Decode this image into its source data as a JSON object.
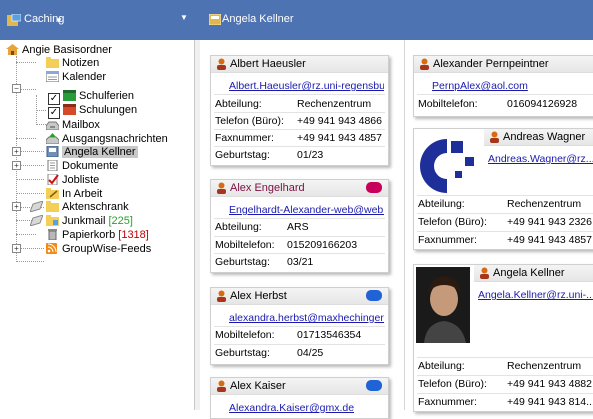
{
  "left_panel": {
    "title": "Caching",
    "tree": [
      {
        "label": "Angie Basisordner"
      },
      {
        "label": "Notizen"
      },
      {
        "label": "Kalender"
      },
      {
        "label": "Schulferien"
      },
      {
        "label": "Schulungen"
      },
      {
        "label": "Mailbox"
      },
      {
        "label": "Ausgangsnachrichten"
      },
      {
        "label": "Angela Kellner"
      },
      {
        "label": "Dokumente"
      },
      {
        "label": "Jobliste"
      },
      {
        "label": "In Arbeit"
      },
      {
        "label": "Aktenschrank"
      },
      {
        "label": "Junkmail",
        "count": "[225]"
      },
      {
        "label": "Papierkorb",
        "count": "[1318]"
      },
      {
        "label": "GroupWise-Feeds"
      }
    ]
  },
  "right_panel": {
    "title": "Angela Kellner",
    "cards": [
      {
        "name": "Albert Haeusler",
        "email": "Albert.Haeusler@rz.uni-regensbu...",
        "fields": [
          {
            "label": "Abteilung:",
            "value": "Rechenzentrum"
          },
          {
            "label": "Telefon (Büro):",
            "value": "+49 941 943 4866"
          },
          {
            "label": "Faxnummer:",
            "value": "+49 941 943 4857"
          },
          {
            "label": "Geburtstag:",
            "value": "01/23"
          }
        ]
      },
      {
        "name": "Alex Engelhard",
        "email": "Engelhardt-Alexander-web@web...",
        "tag_color": "#c8005a",
        "fields": [
          {
            "label": "Abteilung:",
            "value": "ARS"
          },
          {
            "label": "Mobiltelefon:",
            "value": "015209166203"
          },
          {
            "label": "Geburtstag:",
            "value": "03/21"
          }
        ]
      },
      {
        "name": "Alex Herbst",
        "email": "alexandra.herbst@maxhechinger...",
        "tag_color": "#1f63d6",
        "fields": [
          {
            "label": "Mobiltelefon:",
            "value": "01713546354"
          },
          {
            "label": "Geburtstag:",
            "value": "04/25"
          }
        ]
      },
      {
        "name": "Alex Kaiser",
        "email": "Alexandra.Kaiser@gmx.de",
        "tag_color": "#1f63d6",
        "fields": []
      },
      {
        "name": "Alexander Pernpeintner",
        "email": "PernpAlex@aol.com",
        "fields": [
          {
            "label": "Mobiltelefon:",
            "value": "016094126928"
          }
        ]
      },
      {
        "name": "Andreas Wagner",
        "email": "Andreas.Wagner@rz....",
        "fields": [
          {
            "label": "Abteilung:",
            "value": "Rechenzentrum"
          },
          {
            "label": "Telefon (Büro):",
            "value": "+49 941 943 2326"
          },
          {
            "label": "Faxnummer:",
            "value": "+49 941 943 4857"
          }
        ]
      },
      {
        "name": "Angela Kellner",
        "email": "Angela.Kellner@rz.uni-...",
        "fields": [
          {
            "label": "Abteilung:",
            "value": "Rechenzentrum"
          },
          {
            "label": "Telefon (Büro):",
            "value": "+49 941 943 4882"
          },
          {
            "label": "Faxnummer:",
            "value": "+49 941 943 814..."
          }
        ]
      }
    ]
  },
  "colors": {
    "header_bg": "#4d73b3",
    "link": "#1a1ab0",
    "count_green": "#2e9f2e",
    "count_red": "#c00000"
  }
}
